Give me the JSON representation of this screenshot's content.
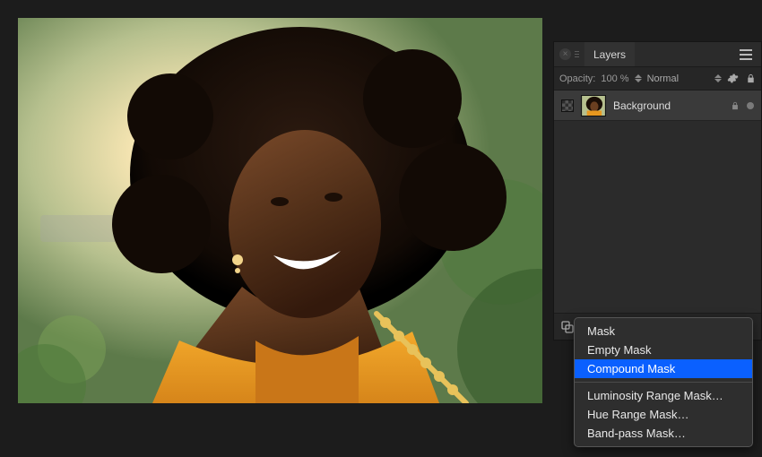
{
  "panel": {
    "tab_label": "Layers",
    "opacity_label": "Opacity:",
    "opacity_value": "100 %",
    "blend_mode": "Normal"
  },
  "layers": [
    {
      "name": "Background",
      "locked": true,
      "visible": true
    }
  ],
  "menu": {
    "items": [
      "Mask",
      "Empty Mask",
      "Compound Mask",
      "Luminosity Range Mask…",
      "Hue Range Mask…",
      "Band-pass Mask…"
    ],
    "selected": "Compound Mask"
  }
}
